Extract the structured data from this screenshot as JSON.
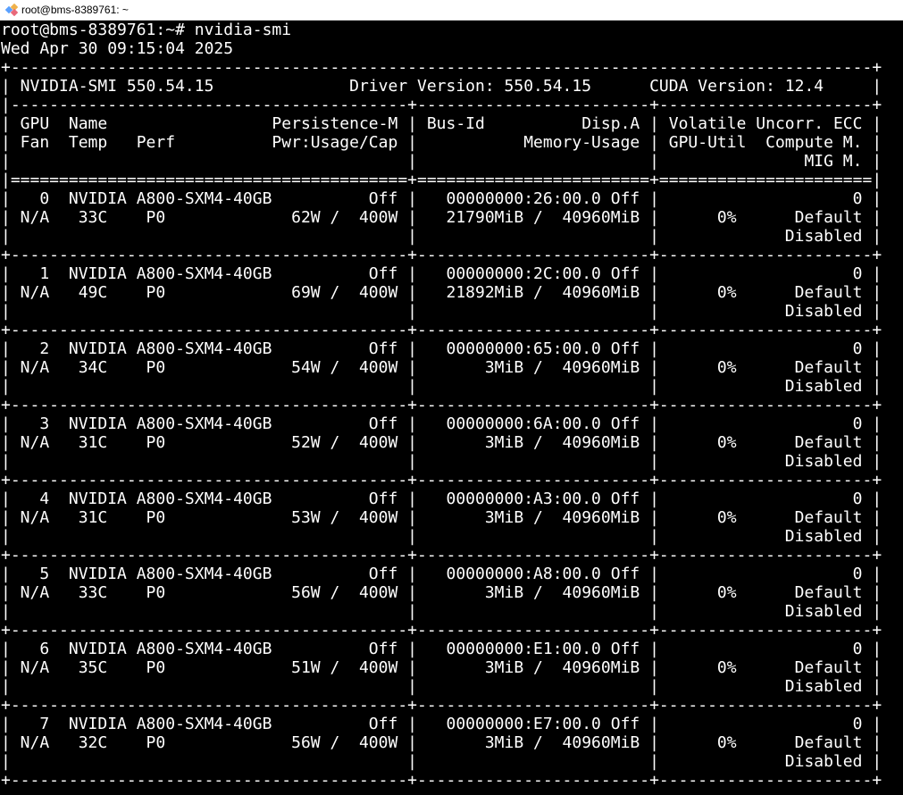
{
  "window": {
    "title": "root@bms-8389761: ~",
    "icon": "putty-app-icon"
  },
  "terminal": {
    "prompt_line": "root@bms-8389761:~# nvidia-smi",
    "date_line": "Wed Apr 30 09:15:04 2025",
    "border_top": "+-----------------------------------------------------------------------------------------+",
    "smi_header": "| NVIDIA-SMI 550.54.15              Driver Version: 550.54.15      CUDA Version: 12.4     |",
    "header_sep": "|-----------------------------------------+------------------------+----------------------+",
    "col_header_1": "| GPU  Name                 Persistence-M | Bus-Id          Disp.A | Volatile Uncorr. ECC |",
    "col_header_2": "| Fan  Temp   Perf          Pwr:Usage/Cap |           Memory-Usage | GPU-Util  Compute M. |",
    "col_header_3": "|                                         |                        |               MIG M. |",
    "double_sep": "|=========================================+========================+======================|",
    "row_sep": "+-----------------------------------------+------------------------+----------------------+",
    "empty_row_3": "|                                         |                        |             Disabled |",
    "gpus": [
      {
        "line1": "|   0  NVIDIA A800-SXM4-40GB          Off |   00000000:26:00.0 Off |                    0 |",
        "line2": "| N/A   33C    P0             62W /  400W |   21790MiB /  40960MiB |      0%      Default |"
      },
      {
        "line1": "|   1  NVIDIA A800-SXM4-40GB          Off |   00000000:2C:00.0 Off |                    0 |",
        "line2": "| N/A   49C    P0             69W /  400W |   21892MiB /  40960MiB |      0%      Default |"
      },
      {
        "line1": "|   2  NVIDIA A800-SXM4-40GB          Off |   00000000:65:00.0 Off |                    0 |",
        "line2": "| N/A   34C    P0             54W /  400W |       3MiB /  40960MiB |      0%      Default |"
      },
      {
        "line1": "|   3  NVIDIA A800-SXM4-40GB          Off |   00000000:6A:00.0 Off |                    0 |",
        "line2": "| N/A   31C    P0             52W /  400W |       3MiB /  40960MiB |      0%      Default |"
      },
      {
        "line1": "|   4  NVIDIA A800-SXM4-40GB          Off |   00000000:A3:00.0 Off |                    0 |",
        "line2": "| N/A   31C    P0             53W /  400W |       3MiB /  40960MiB |      0%      Default |"
      },
      {
        "line1": "|   5  NVIDIA A800-SXM4-40GB          Off |   00000000:A8:00.0 Off |                    0 |",
        "line2": "| N/A   33C    P0             56W /  400W |       3MiB /  40960MiB |      0%      Default |"
      },
      {
        "line1": "|   6  NVIDIA A800-SXM4-40GB          Off |   00000000:E1:00.0 Off |                    0 |",
        "line2": "| N/A   35C    P0             51W /  400W |       3MiB /  40960MiB |      0%      Default |"
      },
      {
        "line1": "|   7  NVIDIA A800-SXM4-40GB          Off |   00000000:E7:00.0 Off |                    0 |",
        "line2": "| N/A   32C    P0             56W /  400W |       3MiB /  40960MiB |      0%      Default |"
      }
    ]
  },
  "colors": {
    "background": "#000000",
    "foreground": "#ffffff"
  }
}
